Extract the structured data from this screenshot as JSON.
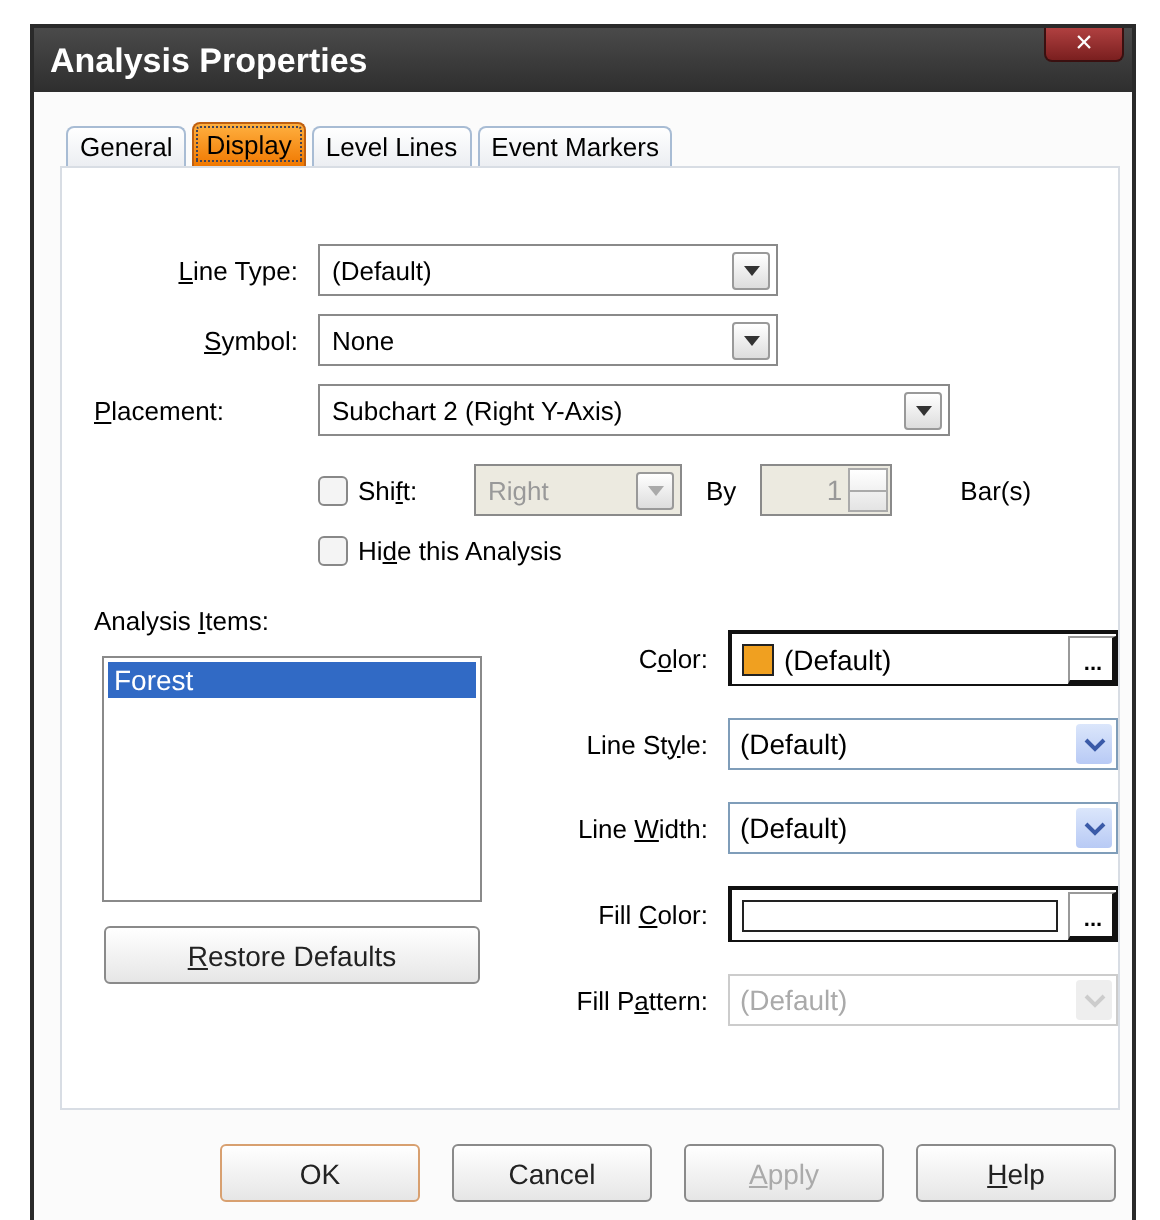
{
  "window": {
    "title": "Analysis Properties",
    "close": "×"
  },
  "tabs": [
    {
      "label": "General",
      "selected": false
    },
    {
      "label": "Display",
      "selected": true
    },
    {
      "label": "Level Lines",
      "selected": false
    },
    {
      "label": "Event Markers",
      "selected": false
    }
  ],
  "fields": [
    {
      "label": {
        "key": "L",
        "after": "ine Type:"
      },
      "value": "(Default)"
    },
    {
      "label": {
        "key": "S",
        "after": "ymbol:"
      },
      "value": "None"
    },
    {
      "label": {
        "key": "P",
        "after": "lacement:"
      },
      "value": "Subchart 2 (Right Y-Axis)"
    }
  ],
  "shift": {
    "checked": false,
    "label": {
      "before": "Shi",
      "key": "f",
      "after": "t:"
    },
    "direction": "Right",
    "by": "By",
    "amount": "1",
    "unit": "Bar(s)",
    "disabled": true
  },
  "hide": {
    "checked": false,
    "label": {
      "before": "Hi",
      "key": "d",
      "after": "e this Analysis"
    }
  },
  "items": {
    "label": {
      "before": "Analysis ",
      "key": "I",
      "after": "tems:"
    },
    "list": [
      {
        "label": "Forest",
        "selected": true
      }
    ],
    "restore": {
      "key": "R",
      "after": "estore Defaults"
    }
  },
  "properties": [
    {
      "kind": "color",
      "label": {
        "before": "C",
        "key": "o",
        "after": "lor:"
      },
      "value": "(Default)",
      "color": "#f0a020",
      "browse": "..."
    },
    {
      "kind": "combo",
      "label": {
        "before": "Line St",
        "key": "y",
        "after": "le:"
      },
      "value": "(Default)",
      "disabled": false
    },
    {
      "kind": "combo",
      "label": {
        "before": "Line ",
        "key": "W",
        "after": "idth:"
      },
      "value": "(Default)",
      "disabled": false
    },
    {
      "kind": "fill",
      "label": {
        "before": "Fill ",
        "key": "C",
        "after": "olor:"
      },
      "color": "#ffffff",
      "browse": "..."
    },
    {
      "kind": "combo",
      "label": {
        "before": "Fill P",
        "key": "a",
        "after": "ttern:"
      },
      "value": "(Default)",
      "disabled": true
    }
  ],
  "buttons": [
    {
      "label": "OK",
      "default": true,
      "disabled": false
    },
    {
      "label": "Cancel",
      "default": false,
      "disabled": false
    },
    {
      "label": {
        "key": "A",
        "after": "pply"
      },
      "default": false,
      "disabled": true
    },
    {
      "label": {
        "key": "H",
        "after": "elp"
      },
      "default": false,
      "disabled": false
    }
  ]
}
